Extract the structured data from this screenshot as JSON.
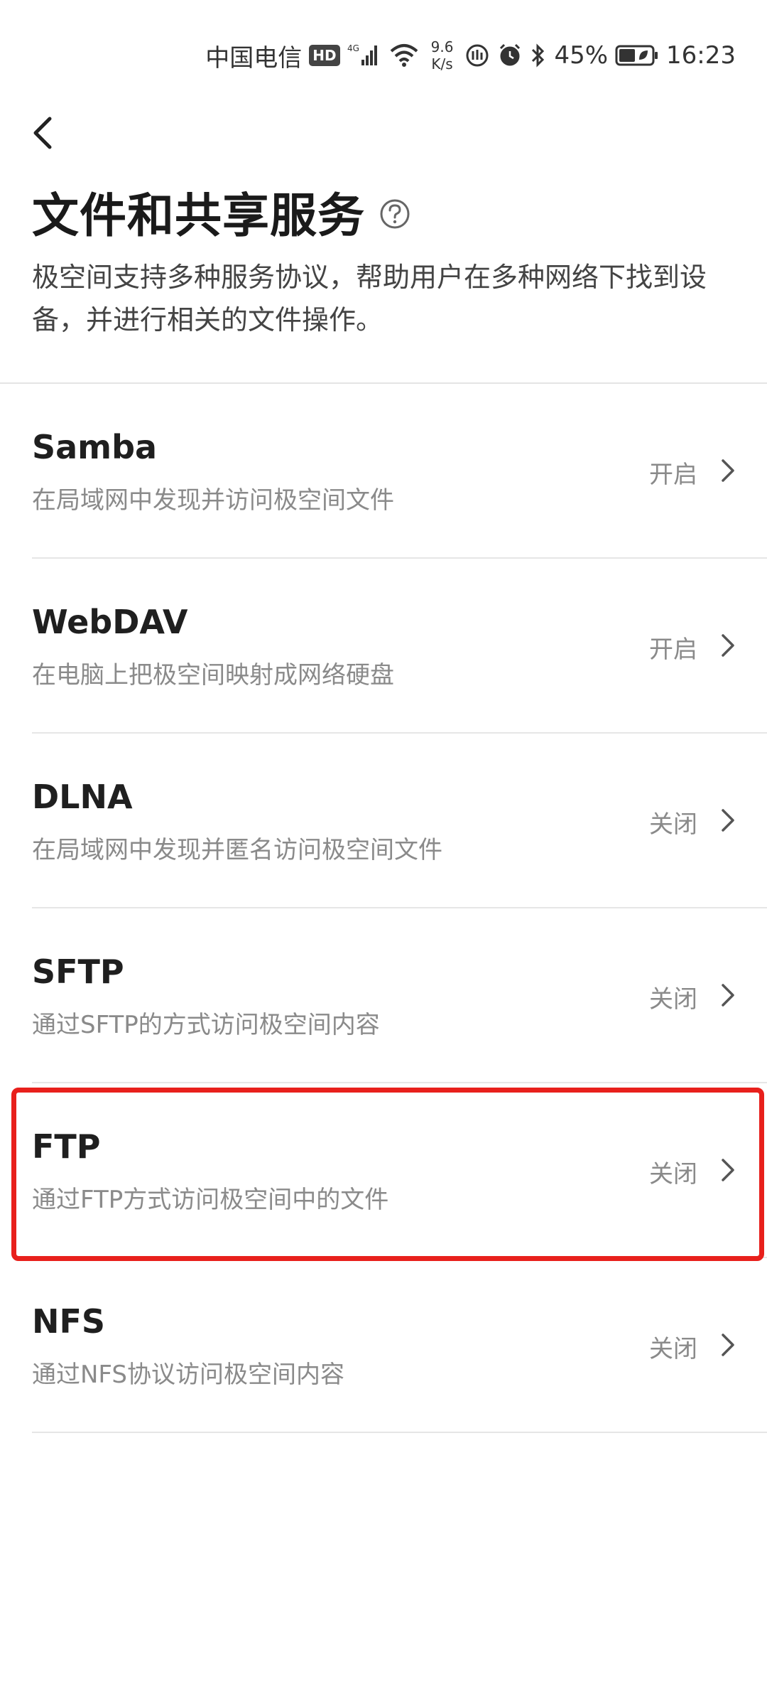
{
  "status_bar": {
    "carrier": "中国电信",
    "hd_badge": "HD",
    "network": "4G",
    "speed_value": "9.6",
    "speed_unit": "K/s",
    "battery": "45%",
    "time": "16:23"
  },
  "header": {
    "title": "文件和共享服务",
    "description": "极空间支持多种服务协议，帮助用户在多种网络下找到设备，并进行相关的文件操作。"
  },
  "services": [
    {
      "name": "Samba",
      "desc": "在局域网中发现并访问极空间文件",
      "status": "开启"
    },
    {
      "name": "WebDAV",
      "desc": "在电脑上把极空间映射成网络硬盘",
      "status": "开启"
    },
    {
      "name": "DLNA",
      "desc": "在局域网中发现并匿名访问极空间文件",
      "status": "关闭"
    },
    {
      "name": "SFTP",
      "desc": "通过SFTP的方式访问极空间内容",
      "status": "关闭"
    },
    {
      "name": "FTP",
      "desc": "通过FTP方式访问极空间中的文件",
      "status": "关闭"
    },
    {
      "name": "NFS",
      "desc": "通过NFS协议访问极空间内容",
      "status": "关闭"
    }
  ],
  "colors": {
    "highlight": "#e8201c",
    "muted_text": "#8a8a8a",
    "divider": "#e6e6e6"
  },
  "icons": {
    "back": "chevron-left-icon",
    "help": "question-circle-icon",
    "row_arrow": "chevron-right-icon"
  }
}
